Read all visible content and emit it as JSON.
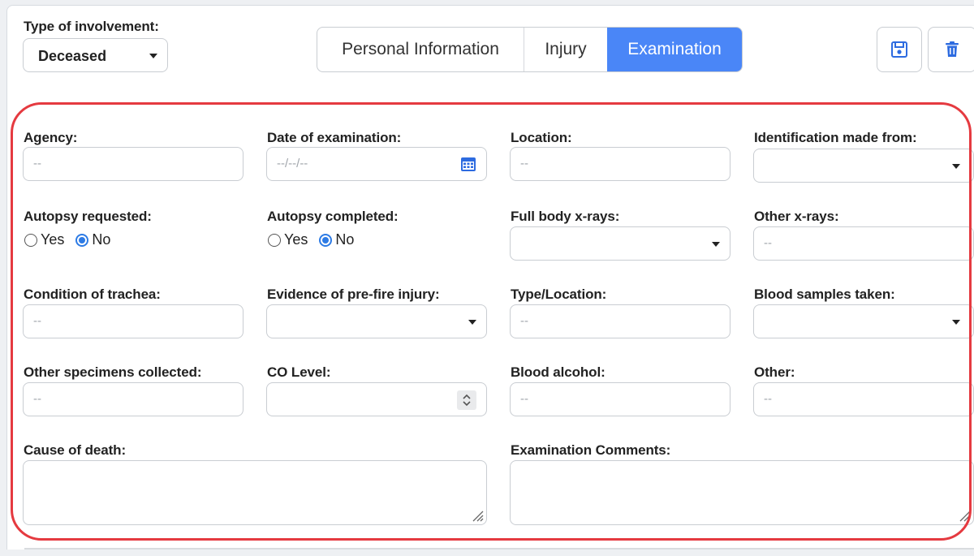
{
  "involvement": {
    "label": "Type of involvement:",
    "value": "Deceased"
  },
  "tabs": [
    {
      "label": "Personal Information",
      "active": false
    },
    {
      "label": "Injury",
      "active": false
    },
    {
      "label": "Examination",
      "active": true
    }
  ],
  "actions": {
    "save_icon": "save-icon",
    "delete_icon": "trash-icon"
  },
  "colors": {
    "accent": "#4a86f7",
    "highlight": "#e53a40"
  },
  "form": {
    "agency": {
      "label": "Agency:",
      "placeholder": "--"
    },
    "date_exam": {
      "label": "Date of examination:",
      "placeholder": "--/--/--"
    },
    "location": {
      "label": "Location:",
      "placeholder": "--"
    },
    "identification": {
      "label": "Identification made from:",
      "value": ""
    },
    "autopsy_requested": {
      "label": "Autopsy requested:",
      "yes": "Yes",
      "no": "No",
      "selected": "No"
    },
    "autopsy_completed": {
      "label": "Autopsy completed:",
      "yes": "Yes",
      "no": "No",
      "selected": "No"
    },
    "full_body_xrays": {
      "label": "Full body x-rays:",
      "value": ""
    },
    "other_xrays": {
      "label": "Other x-rays:",
      "placeholder": "--"
    },
    "trachea": {
      "label": "Condition of trachea:",
      "placeholder": "--"
    },
    "prefire_injury": {
      "label": "Evidence of pre-fire injury:",
      "value": ""
    },
    "type_location": {
      "label": "Type/Location:",
      "placeholder": "--"
    },
    "blood_samples": {
      "label": "Blood samples taken:",
      "value": ""
    },
    "other_specimens": {
      "label": "Other specimens collected:",
      "placeholder": "--"
    },
    "co_level": {
      "label": "CO Level:",
      "value": ""
    },
    "blood_alcohol": {
      "label": "Blood alcohol:",
      "placeholder": "--"
    },
    "other": {
      "label": "Other:",
      "placeholder": "--"
    },
    "cause_of_death": {
      "label": "Cause of death:",
      "value": ""
    },
    "exam_comments": {
      "label": "Examination Comments:",
      "value": ""
    }
  }
}
